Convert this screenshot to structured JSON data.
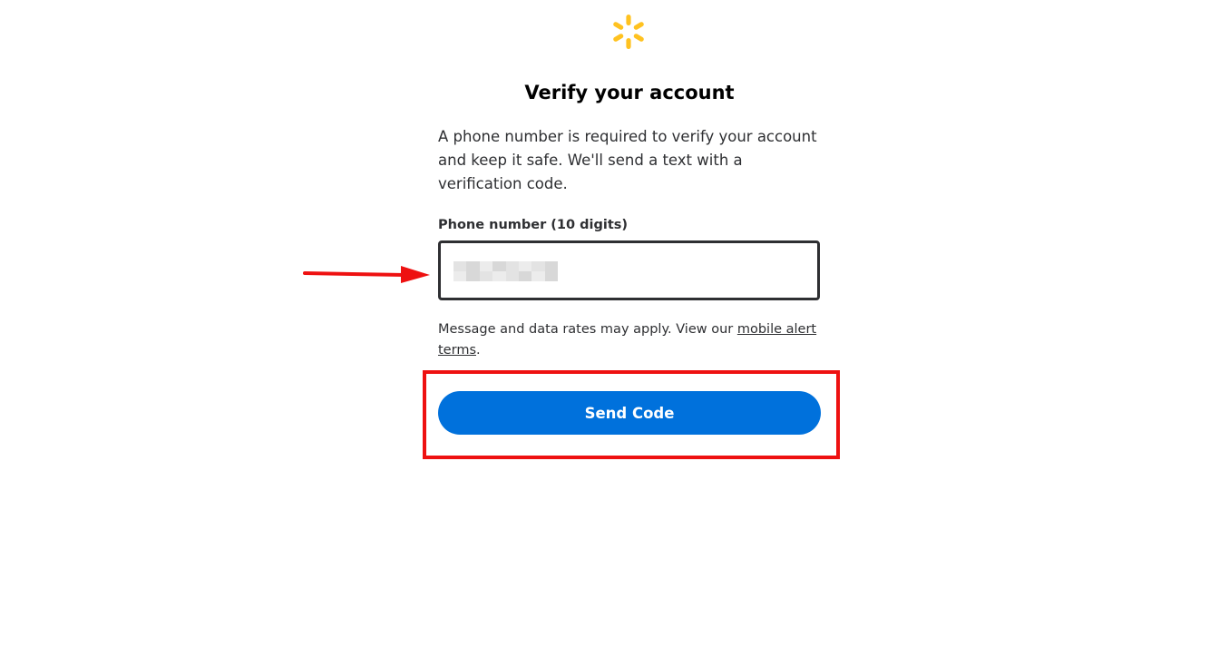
{
  "brand": {
    "logo_icon": "walmart-spark-icon",
    "logo_color": "#ffc220"
  },
  "page": {
    "title": "Verify your account",
    "description": "A phone number is required to verify your account and keep it safe. We'll send a text with a verification code."
  },
  "phone_field": {
    "label": "Phone number (10 digits)",
    "value_obscured": true
  },
  "disclaimer": {
    "text_before": "Message and data rates may apply. View our ",
    "link_text": "mobile alert terms",
    "text_after": "."
  },
  "actions": {
    "send_code_label": "Send Code",
    "button_color": "#0071dc"
  },
  "annotations": {
    "arrow_color": "#ee1111",
    "highlight_color": "#ee1111"
  }
}
